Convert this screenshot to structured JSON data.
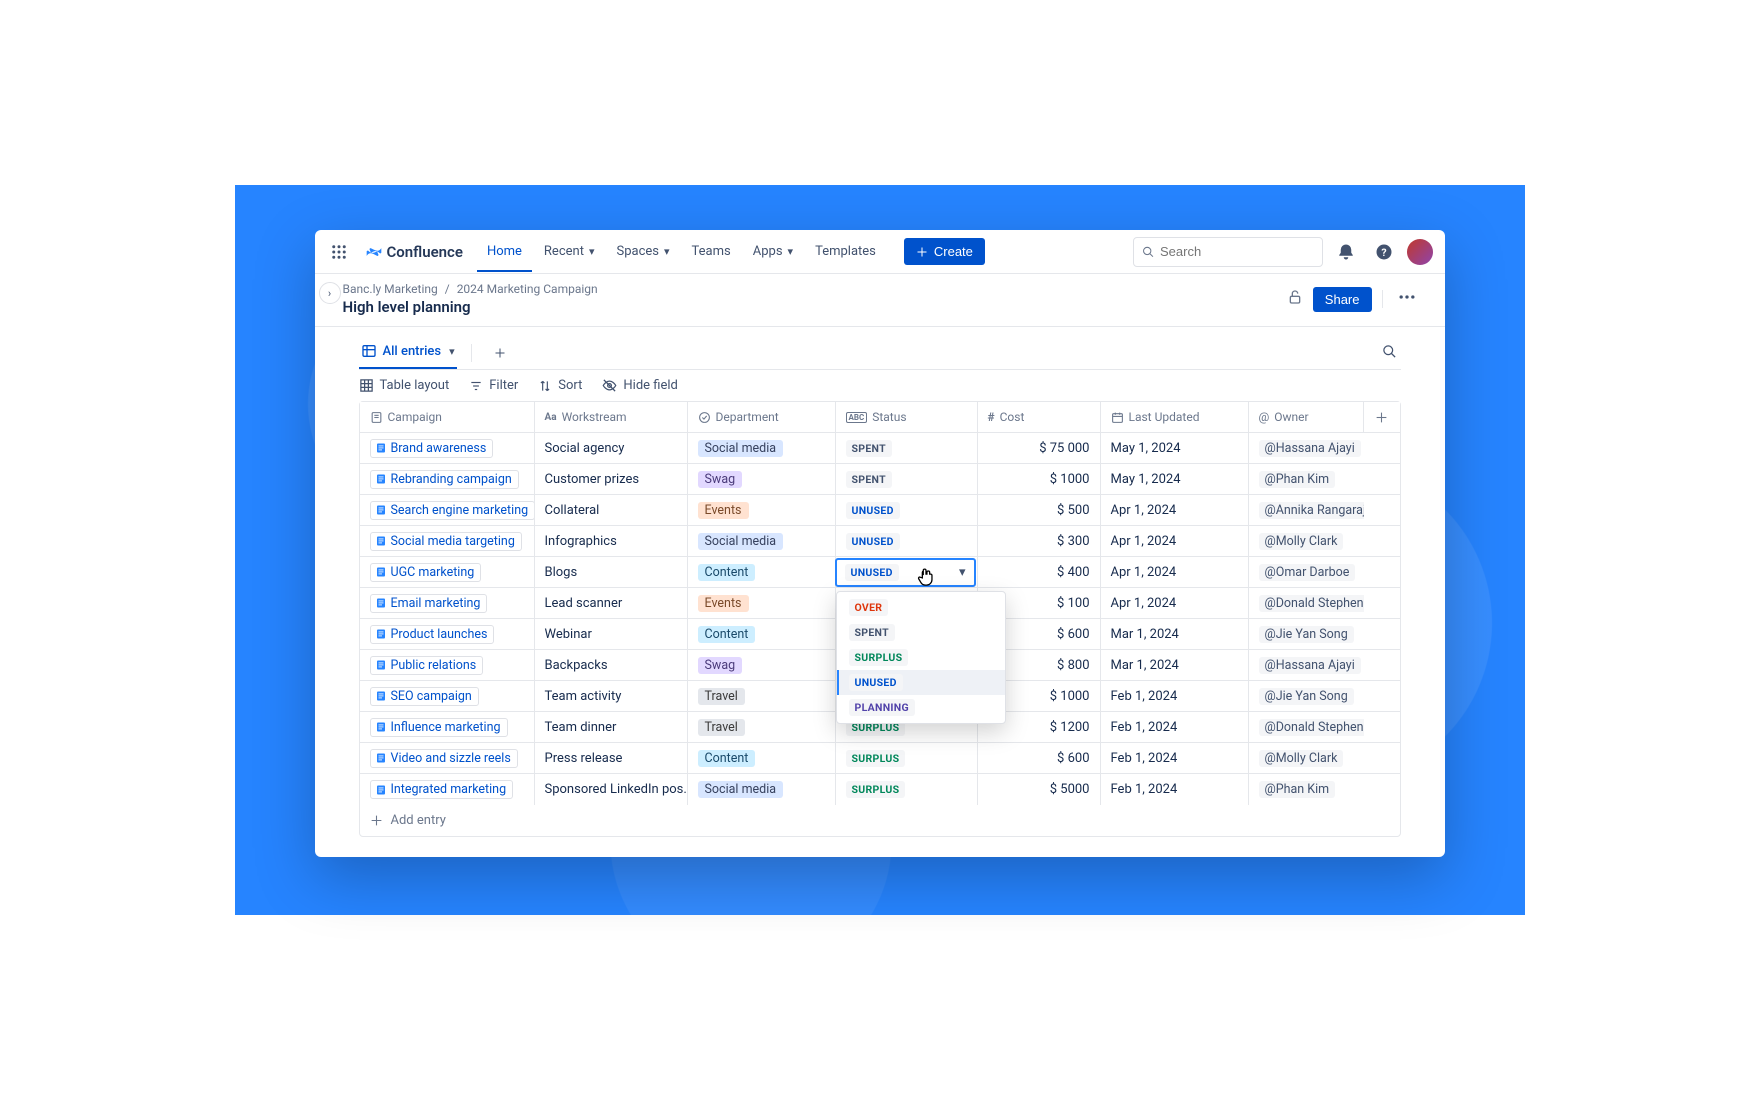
{
  "app": {
    "name": "Confluence"
  },
  "nav": {
    "home": "Home",
    "recent": "Recent",
    "spaces": "Spaces",
    "teams": "Teams",
    "apps": "Apps",
    "templates": "Templates",
    "create": "Create"
  },
  "search": {
    "placeholder": "Search"
  },
  "breadcrumb": {
    "space": "Banc.ly Marketing",
    "parent": "2024 Marketing Campaign"
  },
  "page": {
    "title": "High level planning"
  },
  "actions": {
    "share": "Share"
  },
  "db": {
    "view_name": "All entries",
    "tools": {
      "layout": "Table layout",
      "filter": "Filter",
      "sort": "Sort",
      "hide": "Hide field"
    },
    "columns": {
      "campaign": "Campaign",
      "workstream": "Workstream",
      "department": "Department",
      "status": "Status",
      "cost": "Cost",
      "last_updated": "Last Updated",
      "owner": "Owner"
    },
    "add_entry": "Add entry"
  },
  "status_options": [
    "OVER",
    "SPENT",
    "SURPLUS",
    "UNUSED",
    "PLANNING"
  ],
  "active_status_row_index": 4,
  "rows": [
    {
      "campaign": "Brand awareness",
      "workstream": "Social agency",
      "dept": "Social media",
      "dept_class": "tag-social",
      "status": "SPENT",
      "status_class": "status-spent",
      "cost": "$ 75 000",
      "date": "May 1, 2024",
      "owner": "Hassana Ajayi"
    },
    {
      "campaign": "Rebranding campaign",
      "workstream": "Customer prizes",
      "dept": "Swag",
      "dept_class": "tag-swag",
      "status": "SPENT",
      "status_class": "status-spent",
      "cost": "$ 1000",
      "date": "May 1, 2024",
      "owner": "Phan Kim"
    },
    {
      "campaign": "Search engine marketing",
      "workstream": "Collateral",
      "dept": "Events",
      "dept_class": "tag-events",
      "status": "UNUSED",
      "status_class": "status-unused",
      "cost": "$ 500",
      "date": "Apr 1, 2024",
      "owner": "Annika Rangarajan"
    },
    {
      "campaign": "Social media targeting",
      "workstream": "Infographics",
      "dept": "Social media",
      "dept_class": "tag-social",
      "status": "UNUSED",
      "status_class": "status-unused",
      "cost": "$ 300",
      "date": "Apr 1, 2024",
      "owner": "Molly Clark"
    },
    {
      "campaign": "UGC marketing",
      "workstream": "Blogs",
      "dept": "Content",
      "dept_class": "tag-content",
      "status": "UNUSED",
      "status_class": "status-unused",
      "cost": "$ 400",
      "date": "Apr 1, 2024",
      "owner": "Omar Darboe"
    },
    {
      "campaign": "Email marketing",
      "workstream": "Lead scanner",
      "dept": "Events",
      "dept_class": "tag-events",
      "status": "",
      "status_class": "",
      "cost": "$ 100",
      "date": "Apr 1, 2024",
      "owner": "Donald Stephens"
    },
    {
      "campaign": "Product launches",
      "workstream": "Webinar",
      "dept": "Content",
      "dept_class": "tag-content",
      "status": "",
      "status_class": "",
      "cost": "$ 600",
      "date": "Mar 1, 2024",
      "owner": "Jie Yan Song"
    },
    {
      "campaign": "Public relations",
      "workstream": "Backpacks",
      "dept": "Swag",
      "dept_class": "tag-swag",
      "status": "",
      "status_class": "",
      "cost": "$ 800",
      "date": "Mar 1, 2024",
      "owner": "Hassana Ajayi"
    },
    {
      "campaign": "SEO campaign",
      "workstream": "Team activity",
      "dept": "Travel",
      "dept_class": "tag-travel",
      "status": "",
      "status_class": "",
      "cost": "$ 1000",
      "date": "Feb 1, 2024",
      "owner": "Jie Yan Song"
    },
    {
      "campaign": "Influence marketing",
      "workstream": "Team dinner",
      "dept": "Travel",
      "dept_class": "tag-travel",
      "status": "SURPLUS",
      "status_class": "status-surplus",
      "cost": "$ 1200",
      "date": "Feb 1, 2024",
      "owner": "Donald Stephens"
    },
    {
      "campaign": "Video and sizzle reels",
      "workstream": "Press release",
      "dept": "Content",
      "dept_class": "tag-content",
      "status": "SURPLUS",
      "status_class": "status-surplus",
      "cost": "$ 600",
      "date": "Feb 1, 2024",
      "owner": "Molly Clark"
    },
    {
      "campaign": "Integrated marketing",
      "workstream": "Sponsored LinkedIn pos…",
      "dept": "Social media",
      "dept_class": "tag-social",
      "status": "SURPLUS",
      "status_class": "status-surplus",
      "cost": "$ 5000",
      "date": "Feb 1, 2024",
      "owner": "Phan Kim"
    }
  ]
}
